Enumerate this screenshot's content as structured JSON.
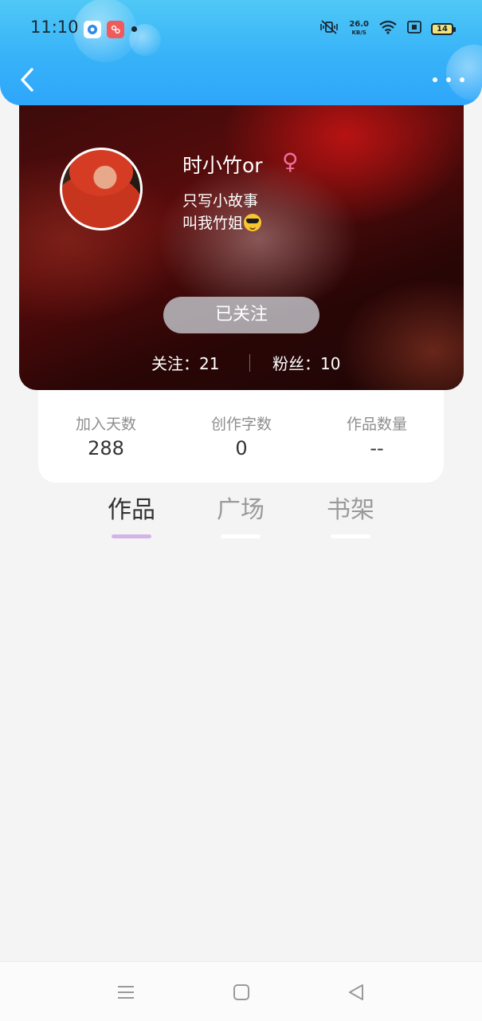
{
  "status_bar": {
    "time": "11:10",
    "net_speed_value": "26.0",
    "net_speed_unit": "KB/S",
    "battery": "14",
    "icons": [
      "app-blue-icon",
      "app-red-icon",
      "mute-vibrate-icon",
      "wifi-icon",
      "screen-icon",
      "battery-icon"
    ]
  },
  "header": {
    "back_icon": "chevron-left-icon",
    "more_icon": "more-dots-icon"
  },
  "profile": {
    "name": "时小竹or",
    "gender_symbol": "♀",
    "bio_line1": "只写小故事",
    "bio_line2": "叫我竹姐",
    "follow_button": "已关注",
    "following": "关注：21",
    "fans": "粉丝：10"
  },
  "stats": [
    {
      "label": "加入天数",
      "value": "288"
    },
    {
      "label": "创作字数",
      "value": "0"
    },
    {
      "label": "作品数量",
      "value": "--"
    }
  ],
  "tabs": [
    {
      "label": "作品",
      "active": true
    },
    {
      "label": "广场",
      "active": false
    },
    {
      "label": "书架",
      "active": false
    }
  ],
  "colors": {
    "header_blue": "#37b2f8",
    "gender_pink": "#ef6f9a",
    "tab_indicator": "#d4b3ea"
  }
}
